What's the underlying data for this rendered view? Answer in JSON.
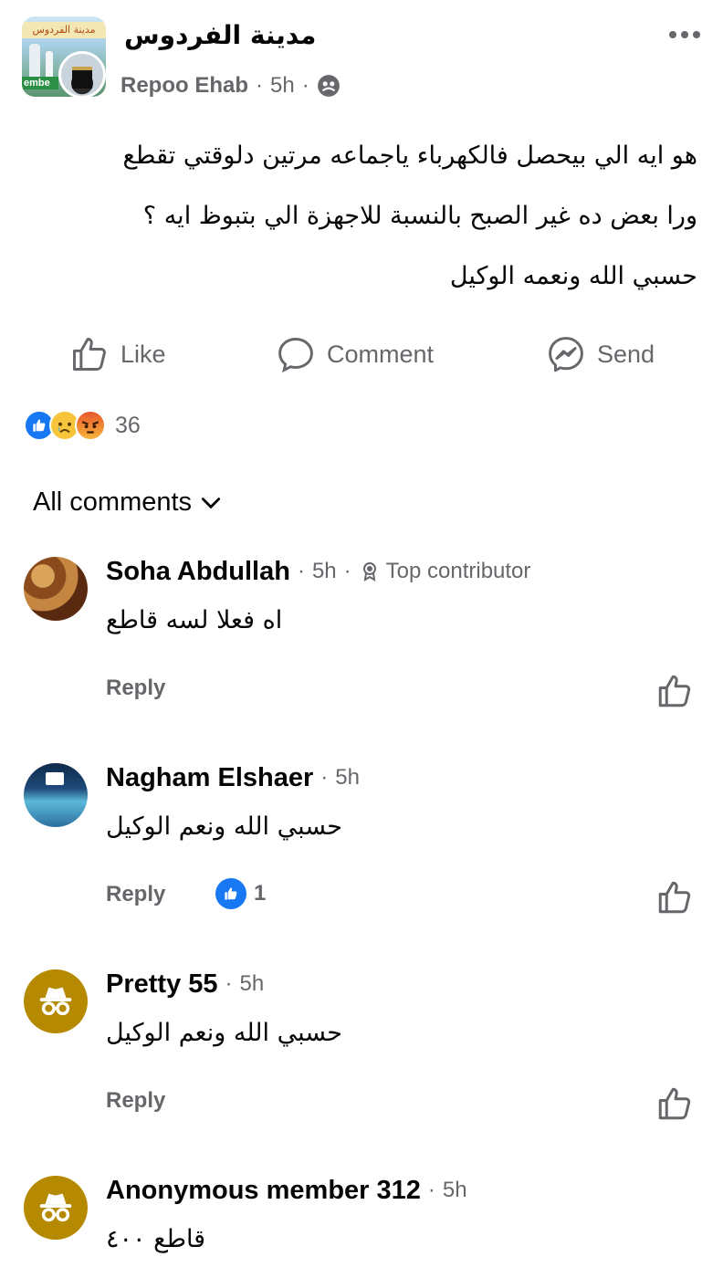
{
  "post": {
    "group_name": "مدينة الفردوس",
    "group_avatar_banner": "مدينة الفردوس",
    "group_avatar_text": "embe",
    "author": "Repoo Ehab",
    "time": "5h",
    "separator": "·",
    "audience_icon": "group-members-icon",
    "more_icon": "more-options-icon",
    "body_lines": [
      "هو ايه الي بيحصل فالكهرباء ياجماعه مرتين دلوقتي تقطع",
      "ورا بعض  ده غير الصبح بالنسبة للاجهزة الي بتبوظ ايه ؟",
      "حسبي الله ونعمه الوكيل"
    ]
  },
  "actions": {
    "like": "Like",
    "comment": "Comment",
    "send": "Send"
  },
  "reactions": {
    "types": [
      "like",
      "sad",
      "angry"
    ],
    "count": "36"
  },
  "comments_filter": {
    "label": "All comments"
  },
  "comments": [
    {
      "name": "Soha Abdullah",
      "time": "5h",
      "badge": "Top contributor",
      "text": "اه فعلا لسه قاطع",
      "reply": "Reply",
      "likes": ""
    },
    {
      "name": "Nagham Elshaer",
      "time": "5h",
      "badge": "",
      "text": "حسبي الله ونعم الوكيل",
      "reply": "Reply",
      "likes": "1"
    },
    {
      "name": "Pretty 55",
      "time": "5h",
      "badge": "",
      "text": "حسبي الله ونعم الوكيل",
      "reply": "Reply",
      "likes": ""
    },
    {
      "name": "Anonymous member 312",
      "time": "5h",
      "badge": "",
      "text": "قاطع ٤٠٠",
      "reply": "",
      "likes": ""
    }
  ],
  "colors": {
    "text_primary": "#050505",
    "text_secondary": "#65676b",
    "like_blue": "#1877f2",
    "anon_avatar": "#b58a00"
  }
}
